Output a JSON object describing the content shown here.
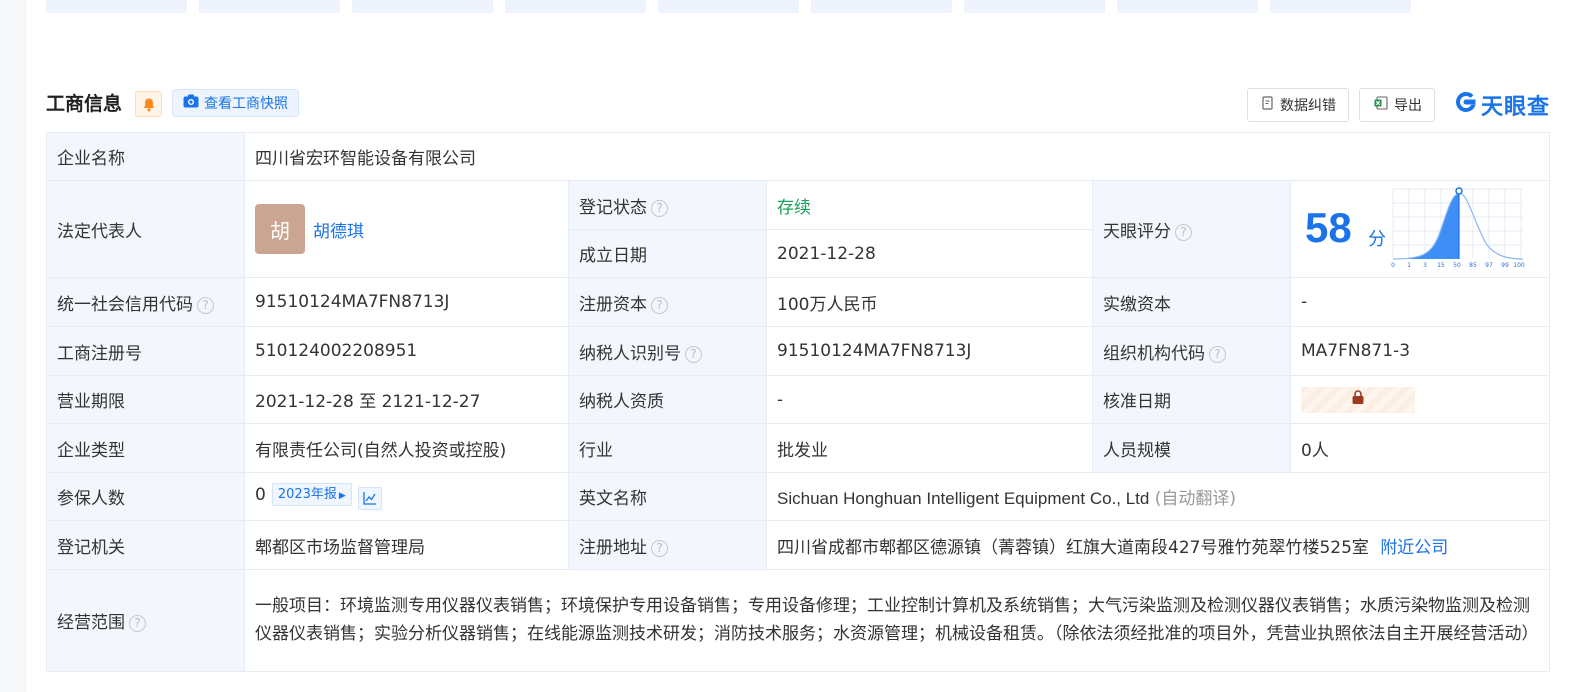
{
  "header": {
    "title": "工商信息",
    "snapshot_label": "查看工商快照",
    "correct_label": "数据纠错",
    "export_label": "导出",
    "logo_text": "天眼查"
  },
  "rows": {
    "company_name": {
      "label": "企业名称",
      "value": "四川省宏环智能设备有限公司"
    },
    "legal_rep": {
      "label": "法定代表人",
      "avatar_char": "胡",
      "name": "胡德琪"
    },
    "reg_status": {
      "label": "登记状态",
      "value": "存续"
    },
    "founded": {
      "label": "成立日期",
      "value": "2021-12-28"
    },
    "score": {
      "label": "天眼评分",
      "value": "58",
      "unit": "分",
      "axis_ticks": [
        "0",
        "1",
        "3",
        "15",
        "50",
        "85",
        "97",
        "99",
        "100"
      ]
    },
    "credit_code": {
      "label": "统一社会信用代码",
      "value": "91510124MA7FN8713J"
    },
    "reg_capital": {
      "label": "注册资本",
      "value": "100万人民币"
    },
    "paid_capital": {
      "label": "实缴资本",
      "value": "-"
    },
    "reg_number": {
      "label": "工商注册号",
      "value": "510124002208951"
    },
    "taxpayer_id": {
      "label": "纳税人识别号",
      "value": "91510124MA7FN8713J"
    },
    "org_code": {
      "label": "组织机构代码",
      "value": "MA7FN871-3"
    },
    "term": {
      "label": "营业期限",
      "value": "2021-12-28 至 2121-12-27"
    },
    "taxpayer_qual": {
      "label": "纳税人资质",
      "value": "-"
    },
    "approved_date": {
      "label": "核准日期"
    },
    "company_type": {
      "label": "企业类型",
      "value": "有限责任公司(自然人投资或控股)"
    },
    "industry": {
      "label": "行业",
      "value": "批发业"
    },
    "staff_size": {
      "label": "人员规模",
      "value": "0人"
    },
    "insured": {
      "label": "参保人数",
      "value": "0",
      "report_badge": "2023年报"
    },
    "english_name": {
      "label": "英文名称",
      "value": "Sichuan Honghuan Intelligent Equipment Co., Ltd",
      "note": "(自动翻译)"
    },
    "authority": {
      "label": "登记机关",
      "value": "郫都区市场监督管理局"
    },
    "address": {
      "label": "注册地址",
      "value": "四川省成都市郫都区德源镇（菁蓉镇）红旗大道南段427号雅竹苑翠竹楼525室",
      "link": "附近公司"
    },
    "scope": {
      "label": "经营范围",
      "value": "一般项目：环境监测专用仪器仪表销售；环境保护专用设备销售；专用设备修理；工业控制计算机及系统销售；大气污染监测及检测仪器仪表销售；水质污染物监测及检测仪器仪表销售；实验分析仪器销售；在线能源监测技术研发；消防技术服务；水资源管理；机械设备租赁。（除依法须经批准的项目外，凭营业执照依法自主开展经营活动）"
    }
  },
  "colors": {
    "accent": "#1a73e8",
    "status_green": "#19a05a",
    "label_bg": "#f3f7fd"
  }
}
